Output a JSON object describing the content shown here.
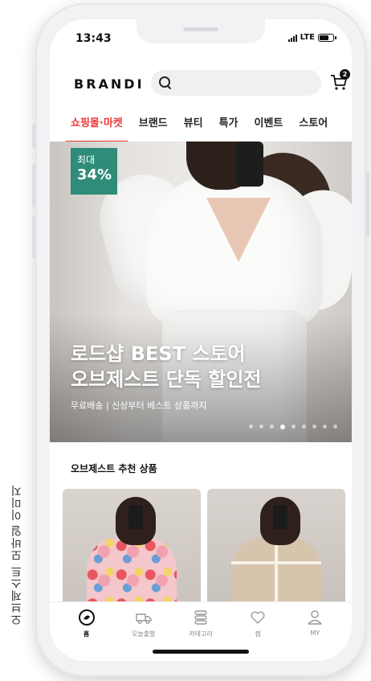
{
  "caption": "오브제스트 모바일 이미지",
  "status": {
    "time": "13:43",
    "network": "LTE"
  },
  "header": {
    "logo": "BRANDI",
    "search_placeholder": "",
    "cart_count": "2"
  },
  "tabs": [
    {
      "label": "쇼핑몰·마켓",
      "active": true
    },
    {
      "label": "브랜드"
    },
    {
      "label": "뷰티"
    },
    {
      "label": "특가"
    },
    {
      "label": "이벤트"
    },
    {
      "label": "스토어"
    }
  ],
  "banner": {
    "badge_top": "최대",
    "badge_value": "34%",
    "title_line1": "로드샵 BEST 스토어",
    "title_line2": "오브제스트 단독 할인전",
    "subtitle": "무료배송 | 신상부터 베스트 상품까지",
    "slide_count": 9,
    "active_slide": 3
  },
  "section": {
    "title": "오브제스트 추천 상품"
  },
  "bottom_nav": [
    {
      "label": "홈",
      "icon": "home-icon",
      "active": true
    },
    {
      "label": "오늘출발",
      "icon": "truck-icon"
    },
    {
      "label": "카테고리",
      "icon": "category-icon"
    },
    {
      "label": "찜",
      "icon": "heart-icon"
    },
    {
      "label": "MY",
      "icon": "user-icon"
    }
  ],
  "colors": {
    "accent": "#e83a3a",
    "badge": "#2f8c78"
  }
}
